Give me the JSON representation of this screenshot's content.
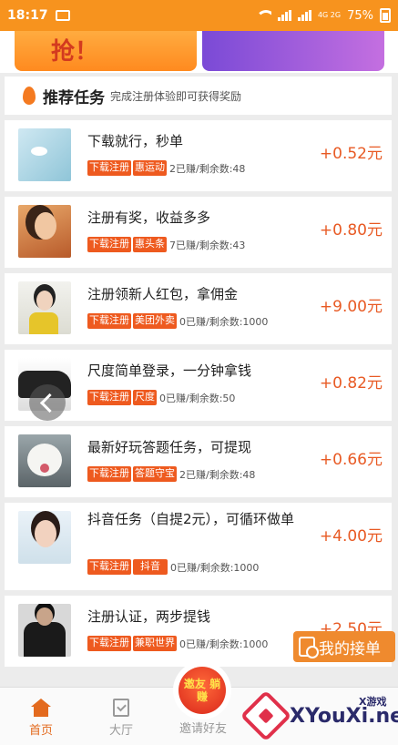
{
  "status_bar": {
    "time": "18:17",
    "network_tag": "4G 2G",
    "battery": "75%"
  },
  "banner": {
    "left_text": "抢！"
  },
  "section": {
    "title": "推荐任务",
    "subtitle": "完成注册体验即可获得奖励"
  },
  "tasks": [
    {
      "name": "下载就行，秒单",
      "tags": [
        "下载注册",
        "惠运动"
      ],
      "stats": "2已赚/剩余数:48",
      "reward": "+0.52元"
    },
    {
      "name": "注册有奖，收益多多",
      "tags": [
        "下载注册",
        "惠头条"
      ],
      "stats": "7已赚/剩余数:43",
      "reward": "+0.80元"
    },
    {
      "name": "注册领新人红包，拿佣金",
      "tags": [
        "下载注册",
        "美团外卖"
      ],
      "stats": "0已赚/剩余数:1000",
      "reward": "+9.00元"
    },
    {
      "name": "尺度简单登录，一分钟拿钱",
      "tags": [
        "下载注册",
        "尺度"
      ],
      "stats": "0已赚/剩余数:50",
      "reward": "+0.82元"
    },
    {
      "name": "最新好玩答题任务，可提现",
      "tags": [
        "下载注册",
        "答题守宝"
      ],
      "stats": "2已赚/剩余数:48",
      "reward": "+0.66元"
    },
    {
      "name": "抖音任务（自提2元），可循环做单",
      "tags": [
        "下载注册",
        "抖音"
      ],
      "stats": "0已赚/剩余数:1000",
      "reward": "+4.00元"
    },
    {
      "name": "注册认证，两步提钱",
      "tags": [
        "下载注册",
        "兼职世界"
      ],
      "stats": "0已赚/剩余数:1000",
      "reward": "+2.50元"
    }
  ],
  "floating_button": {
    "label": "我的接单"
  },
  "bottom_nav": {
    "home": "首页",
    "hall": "大厅",
    "invite": "邀请好友",
    "invite_badge": "邀友 躺赚"
  },
  "watermark": {
    "site": "XYouXi.net",
    "small": "X游戏"
  },
  "colors": {
    "accent": "#f7931e",
    "tag": "#ee5a1f",
    "reward": "#e85a24"
  }
}
